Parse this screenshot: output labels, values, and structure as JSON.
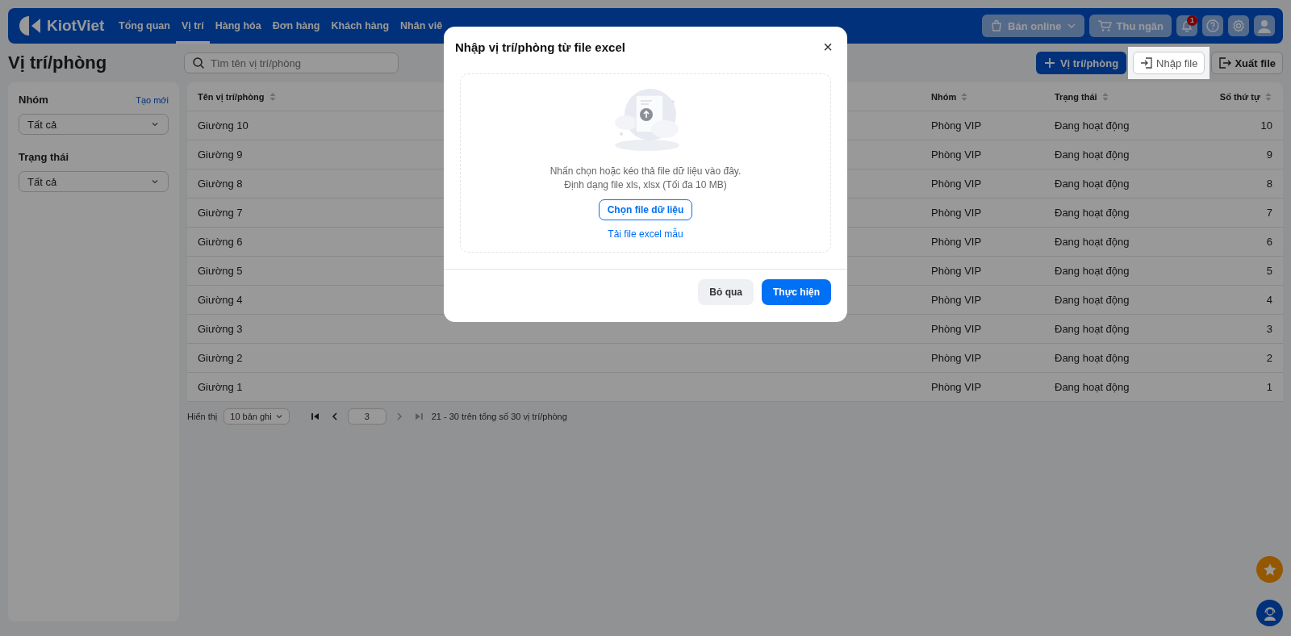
{
  "header": {
    "brand": "KiotViet",
    "nav": [
      {
        "label": "Tổng quan",
        "selected": false
      },
      {
        "label": "Vị trí",
        "selected": true
      },
      {
        "label": "Hàng hóa",
        "selected": false
      },
      {
        "label": "Đơn hàng",
        "selected": false
      },
      {
        "label": "Khách hàng",
        "selected": false
      },
      {
        "label": "Nhân viê",
        "selected": false
      }
    ],
    "online_button": "Bán online",
    "cashier_button": "Thu ngân",
    "notification_count": "1"
  },
  "page_title": "Vị trí/phòng",
  "search": {
    "placeholder": "Tìm tên vị trí/phòng"
  },
  "actions": {
    "add": "Vị trí/phòng",
    "import": "Nhập file",
    "export": "Xuất file"
  },
  "sidebar": {
    "filters": [
      {
        "label": "Nhóm",
        "link": "Tạo mới",
        "value": "Tất cả"
      },
      {
        "label": "Trạng thái",
        "value": "Tất cả"
      }
    ]
  },
  "table": {
    "columns": [
      {
        "label": "Tên vị trí/phòng"
      },
      {
        "label": "Nhóm"
      },
      {
        "label": "Trạng thái"
      },
      {
        "label": "Số thứ tự"
      }
    ],
    "rows": [
      [
        "Giường 10",
        "Phòng VIP",
        "Đang hoạt động",
        "10"
      ],
      [
        "Giường 9",
        "Phòng VIP",
        "Đang hoạt động",
        "9"
      ],
      [
        "Giường 8",
        "Phòng VIP",
        "Đang hoạt động",
        "8"
      ],
      [
        "Giường 7",
        "Phòng VIP",
        "Đang hoạt động",
        "7"
      ],
      [
        "Giường 6",
        "Phòng VIP",
        "Đang hoạt động",
        "6"
      ],
      [
        "Giường 5",
        "Phòng VIP",
        "Đang hoạt động",
        "5"
      ],
      [
        "Giường 4",
        "Phòng VIP",
        "Đang hoạt động",
        "4"
      ],
      [
        "Giường 3",
        "Phòng VIP",
        "Đang hoạt động",
        "3"
      ],
      [
        "Giường 2",
        "Phòng VIP",
        "Đang hoạt động",
        "2"
      ],
      [
        "Giường 1",
        "Phòng VIP",
        "Đang hoạt động",
        "1"
      ]
    ]
  },
  "pagination": {
    "label": "Hiển thị",
    "page_size": "10 bản ghi",
    "page": "3",
    "summary": "21 - 30 trên tổng số 30 vị trí/phòng"
  },
  "dialog": {
    "title": "Nhập vị trí/phòng từ file excel",
    "close": "×",
    "hint_lines": [
      "Nhấn chọn hoặc kéo thả file dữ liệu vào đây.",
      "Định dạng file xls, xlsx (Tối đa 10 MB)"
    ],
    "choose_button": "Chọn file dữ liệu",
    "template_link": "Tải file excel mẫu",
    "cancel_button": "Bỏ qua",
    "submit_button": "Thực hiện"
  }
}
